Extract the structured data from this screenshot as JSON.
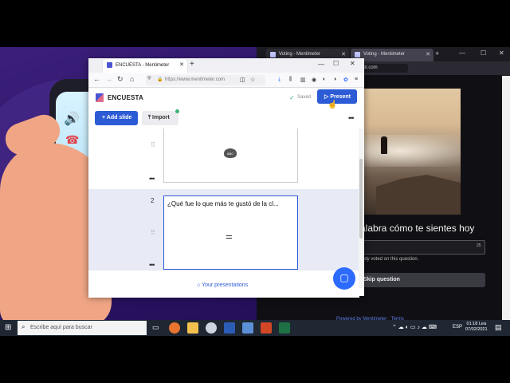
{
  "main_browser": {
    "tab_title": "ENCUESTA - Mentimeter",
    "url": "https://www.mentimeter.com",
    "new_tab": "+",
    "minimize": "—",
    "maximize": "☐",
    "close": "✕"
  },
  "menti": {
    "presentation_title": "ENCUESTA",
    "saved_label": "Saved",
    "present_label": "Present",
    "add_slide_label": "+ Add slide",
    "import_label": "Import",
    "more_label": "•••",
    "slides": [
      {
        "number": "",
        "text": "",
        "icon_label": "ABC"
      },
      {
        "number": "2",
        "text": "¿Qué fue lo que más te gustó de la cl...",
        "icon_label": ""
      }
    ],
    "footer_link": "Your presentations"
  },
  "right_browser": {
    "tabs": [
      {
        "title": "Voting - Mentimeter"
      },
      {
        "title": "Voting - Mentimeter"
      }
    ],
    "url": "menti.com",
    "question": "alabra cómo te sientes hoy",
    "counter": "25",
    "voted_text": "ody voted on this question.",
    "skip_label": "Skip question",
    "footer": "Powered by Mentimeter · Terms"
  },
  "taskbar": {
    "search_placeholder": "Escribe aquí para buscar",
    "language": "ESP",
    "time": "01:18 Lea",
    "date": "07/02/2021"
  },
  "colors": {
    "menti_blue": "#2d5bd6",
    "saved_green": "#3bb273",
    "bg_purple": "#2d1466",
    "skin": "#f0a685"
  }
}
